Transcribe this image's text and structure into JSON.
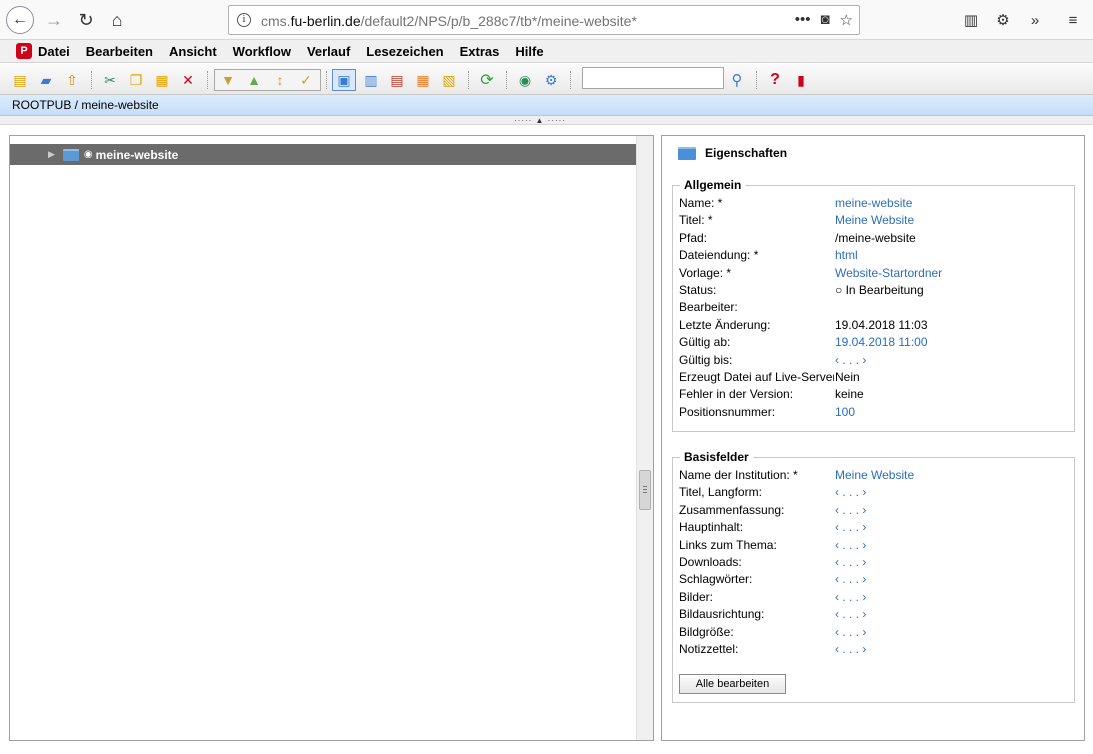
{
  "browser": {
    "url_prefix": "cms.",
    "url_domain": "fu-berlin.de",
    "url_path": "/default2/NPS/p/b_288c7/tb*/meine-website*"
  },
  "menu": {
    "items": [
      "Datei",
      "Bearbeiten",
      "Ansicht",
      "Workflow",
      "Verlauf",
      "Lesezeichen",
      "Extras",
      "Hilfe"
    ]
  },
  "toolbar": {
    "search_value": ""
  },
  "breadcrumb": "ROOTPUB / meine-website",
  "tree": {
    "items": [
      {
        "label": "meine-website"
      }
    ]
  },
  "properties": {
    "title": "Eigenschaften",
    "allgemein": {
      "legend": "Allgemein",
      "rows": [
        {
          "label": "Name: *",
          "value": "meine-website",
          "link": true
        },
        {
          "label": "Titel: *",
          "value": "Meine Website",
          "link": true
        },
        {
          "label": "Pfad:",
          "value": "/meine-website",
          "link": false
        },
        {
          "label": "Dateiendung: *",
          "value": "html",
          "link": true
        },
        {
          "label": "Vorlage: *",
          "value": "Website-Startordner",
          "link": true
        },
        {
          "label": "Status:",
          "value": "○ In Bearbeitung",
          "link": false
        },
        {
          "label": "Bearbeiter:",
          "value": "",
          "link": false
        },
        {
          "label": "Letzte Änderung:",
          "value": "19.04.2018 11:03",
          "link": false
        },
        {
          "label": "Gültig ab:",
          "value": "19.04.2018 11:00",
          "link": true
        },
        {
          "label": "Gültig bis:",
          "value": "‹ . . . ›",
          "link": true
        },
        {
          "label": "Erzeugt Datei auf Live-Server:",
          "value": "Nein",
          "link": false
        },
        {
          "label": "Fehler in der Version:",
          "value": "keine",
          "link": false
        },
        {
          "label": "Positionsnummer:",
          "value": "100",
          "link": true
        }
      ]
    },
    "basisfelder": {
      "legend": "Basisfelder",
      "rows": [
        {
          "label": "Name der Institution: *",
          "value": "Meine Website",
          "link": true
        },
        {
          "label": "Titel, Langform:",
          "value": "‹ . . . ›",
          "link": true
        },
        {
          "label": "Zusammenfassung:",
          "value": "‹ . . . ›",
          "link": true
        },
        {
          "label": "Hauptinhalt:",
          "value": "‹ . . . ›",
          "link": true
        },
        {
          "label": "Links zum Thema:",
          "value": "‹ . . . ›",
          "link": true
        },
        {
          "label": "Downloads:",
          "value": "‹ . . . ›",
          "link": true
        },
        {
          "label": "Schlagwörter:",
          "value": "‹ . . . ›",
          "link": true
        },
        {
          "label": "Bilder:",
          "value": "‹ . . . ›",
          "link": true
        },
        {
          "label": "Bildausrichtung:",
          "value": "‹ . . . ›",
          "link": true
        },
        {
          "label": "Bildgröße:",
          "value": "‹ . . . ›",
          "link": true
        },
        {
          "label": "Notizzettel:",
          "value": "‹ . . . ›",
          "link": true
        }
      ],
      "edit_all_label": "Alle bearbeiten"
    }
  },
  "colors": {
    "link": "#2a6ebb",
    "selected_row": "#6b6b6b",
    "breadcrumb_bg": "#c5ddf8"
  }
}
